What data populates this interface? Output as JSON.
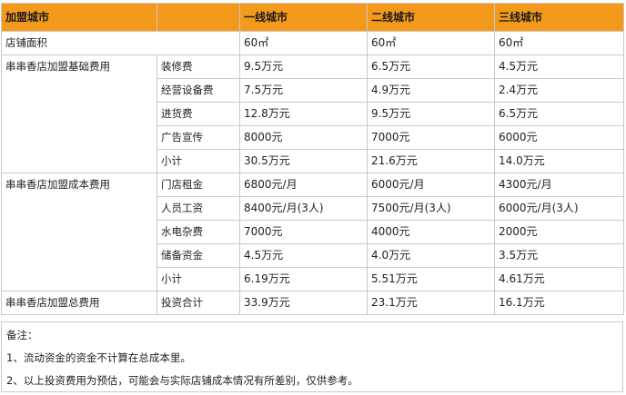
{
  "header": [
    "加盟城市",
    "",
    "一线城市",
    "二线城市",
    "三线城市"
  ],
  "area_row": {
    "label": "店铺面积",
    "values": [
      "60㎡",
      "60㎡",
      "60㎡"
    ]
  },
  "groups": [
    {
      "name": "串串香店加盟基础费用",
      "rows": [
        {
          "item": "装修费",
          "values": [
            "9.5万元",
            "6.5万元",
            "4.5万元"
          ]
        },
        {
          "item": "经营设备费",
          "values": [
            "7.5万元",
            "4.9万元",
            "2.4万元"
          ]
        },
        {
          "item": "进货费",
          "values": [
            "12.8万元",
            "9.5万元",
            "6.5万元"
          ]
        },
        {
          "item": "广告宣传",
          "values": [
            "8000元",
            "7000元",
            "6000元"
          ]
        },
        {
          "item": "小计",
          "values": [
            "30.5万元",
            "21.6万元",
            "14.0万元"
          ]
        }
      ]
    },
    {
      "name": "串串香店加盟成本费用",
      "rows": [
        {
          "item": "门店租金",
          "values": [
            "6800元/月",
            "6000元/月",
            "4300元/月"
          ]
        },
        {
          "item": "人员工资",
          "values": [
            "8400元/月(3人)",
            "7500元/月(3人)",
            "6000元/月(3人)"
          ]
        },
        {
          "item": "水电杂费",
          "values": [
            "7000元",
            "4000元",
            "2000元"
          ]
        },
        {
          "item": "储备资金",
          "values": [
            "4.5万元",
            "4.0万元",
            "3.5万元"
          ]
        },
        {
          "item": "小计",
          "values": [
            "6.19万元",
            "5.51万元",
            "4.61万元"
          ]
        }
      ]
    }
  ],
  "total_row": {
    "label": "串串香店加盟总费用",
    "item": "投资合计",
    "values": [
      "33.9万元",
      "23.1万元",
      "16.1万元"
    ]
  },
  "notes": [
    "备注：",
    "1、流动资金的资金不计算在总成本里。",
    "2、以上投资费用为预估，可能会与实际店铺成本情况有所差别，仅供参考。"
  ],
  "colors": {
    "header_bg": "#f39a1d",
    "border": "#c9c9c9",
    "text": "#222222"
  }
}
